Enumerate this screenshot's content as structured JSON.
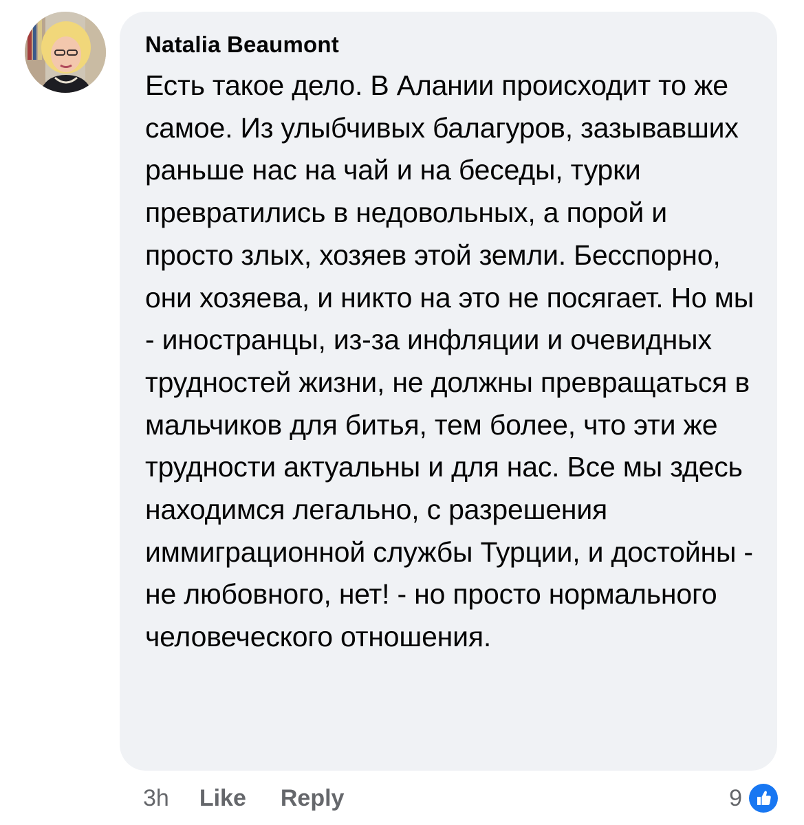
{
  "comment": {
    "author": "Natalia Beaumont",
    "text": "Есть такое дело. В Алании происходит то же самое. Из улыбчивых балагуров, зазывавших раньше нас на чай и на беседы, турки превратились в недовольных, а порой и просто злых, хозяев этой земли. Бесспорно, они хозяева, и никто на это не посягает. Но мы - иностранцы, из-за инфляции и очевидных трудностей жизни, не должны превращаться в мальчиков для битья, тем более, что эти же трудности актуальны и для нас. Все мы здесь находимся легально, с разрешения иммиграционной службы Турции, и достойны - не любовного, нет! - но просто нормального человеческого отношения."
  },
  "meta": {
    "time": "3h",
    "like_label": "Like",
    "reply_label": "Reply"
  },
  "reactions": {
    "count": "9",
    "icon": "like-thumbs-up-icon"
  },
  "colors": {
    "bubble_bg": "#f0f2f5",
    "text": "#050505",
    "meta_text": "#65676b",
    "like_blue": "#1877f2"
  }
}
